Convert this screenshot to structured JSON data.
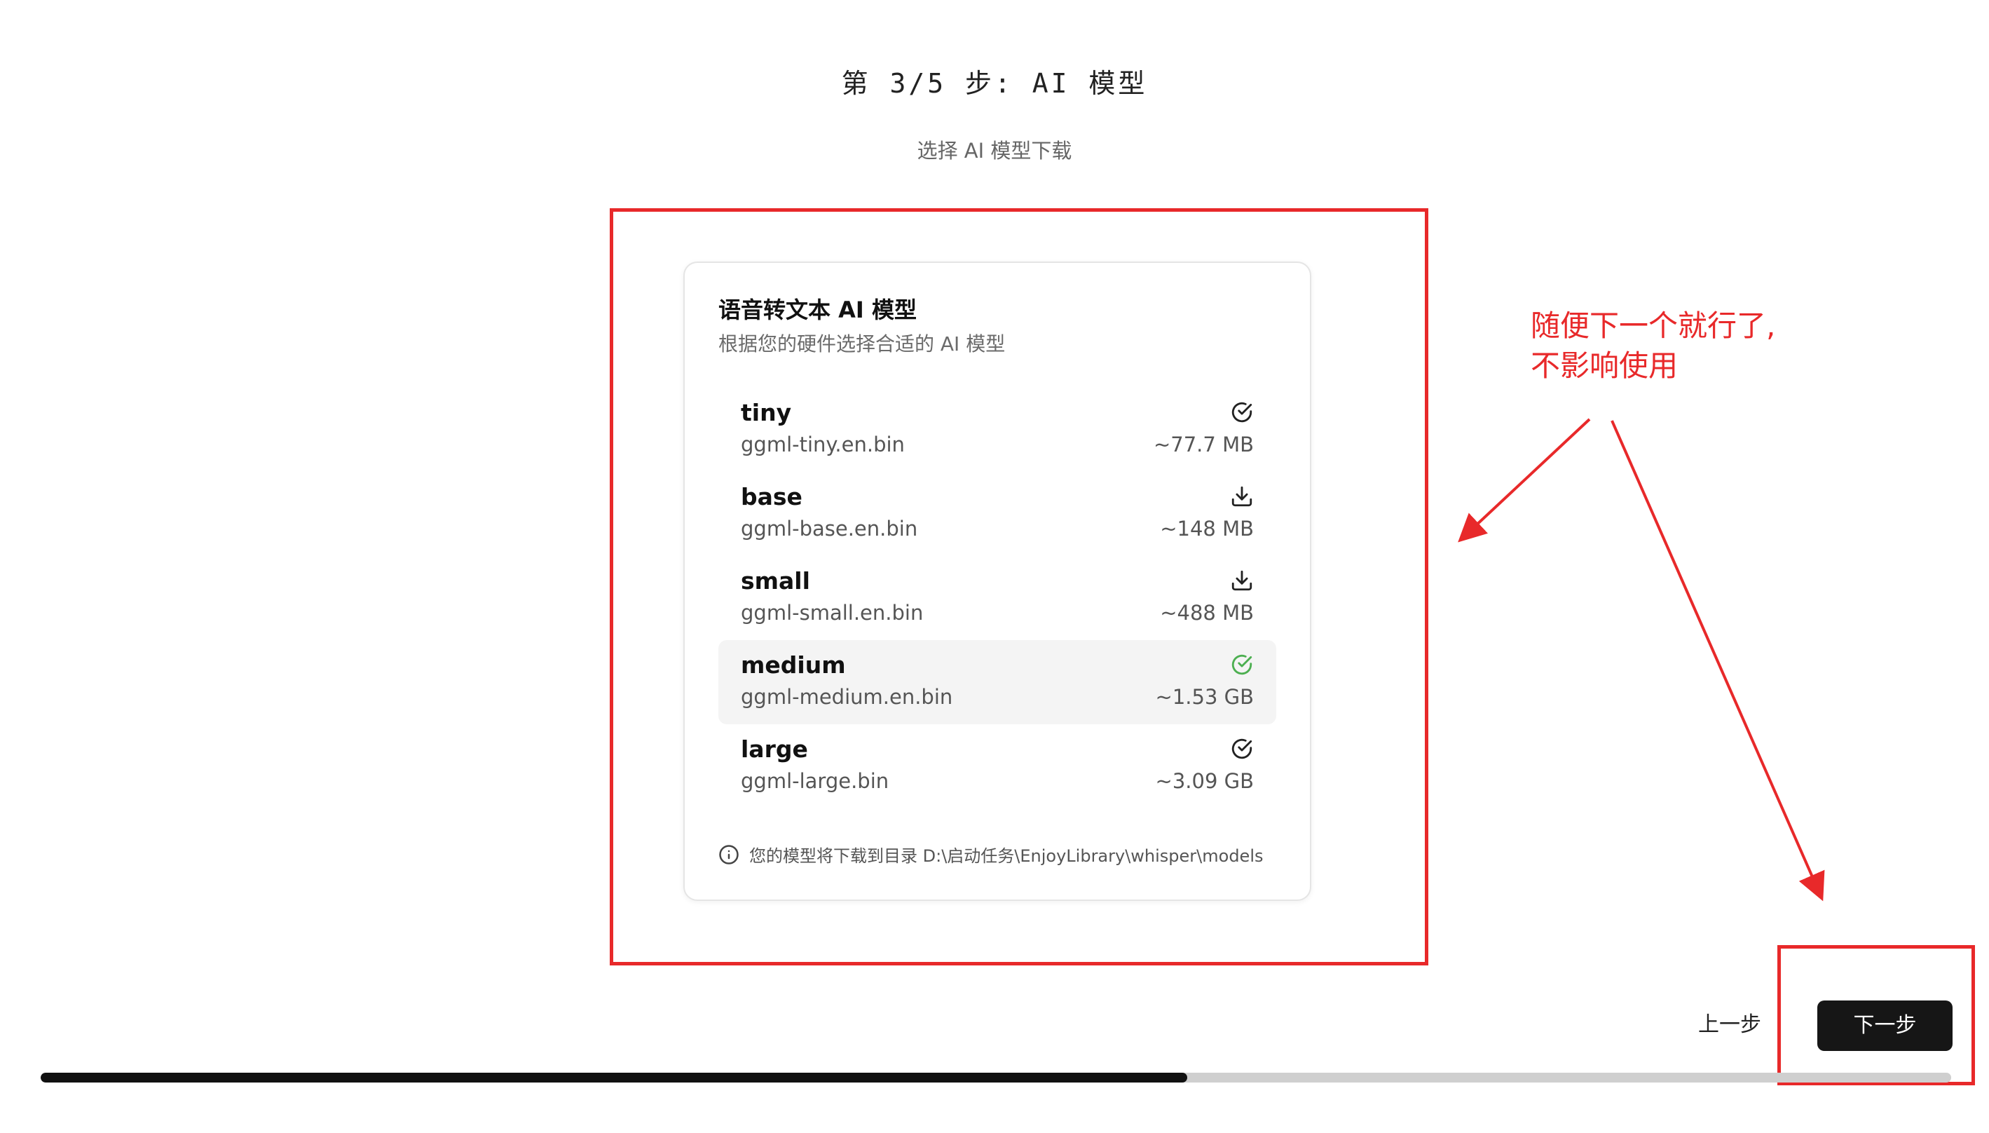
{
  "header": {
    "step_title": "第 3/5 步: AI 模型",
    "subtitle": "选择 AI 模型下载"
  },
  "card": {
    "title": "语音转文本 AI 模型",
    "description": "根据您的硬件选择合适的 AI 模型",
    "models": [
      {
        "name": "tiny",
        "file": "ggml-tiny.en.bin",
        "size": "~77.7 MB",
        "status": "downloaded",
        "icon": "check-circle-icon",
        "selected": false
      },
      {
        "name": "base",
        "file": "ggml-base.en.bin",
        "size": "~148 MB",
        "status": "not-downloaded",
        "icon": "download-icon",
        "selected": false
      },
      {
        "name": "small",
        "file": "ggml-small.en.bin",
        "size": "~488 MB",
        "status": "not-downloaded",
        "icon": "download-icon",
        "selected": false
      },
      {
        "name": "medium",
        "file": "ggml-medium.en.bin",
        "size": "~1.53 GB",
        "status": "downloaded",
        "icon": "check-circle-icon",
        "selected": true
      },
      {
        "name": "large",
        "file": "ggml-large.bin",
        "size": "~3.09 GB",
        "status": "downloaded",
        "icon": "check-circle-icon",
        "selected": false
      }
    ],
    "note": "您的模型将下载到目录 D:\\启动任务\\EnjoyLibrary\\whisper\\models"
  },
  "annotation": {
    "text_line1": "随便下一个就行了,",
    "text_line2": "不影响使用",
    "color": "#e8292a"
  },
  "nav": {
    "prev_label": "上一步",
    "next_label": "下一步"
  },
  "progress": {
    "fraction": 0.6,
    "color_fill": "#111111",
    "color_track": "#cfcfcf"
  },
  "colors": {
    "selected_check": "#4caf50",
    "default_icon": "#222222"
  }
}
